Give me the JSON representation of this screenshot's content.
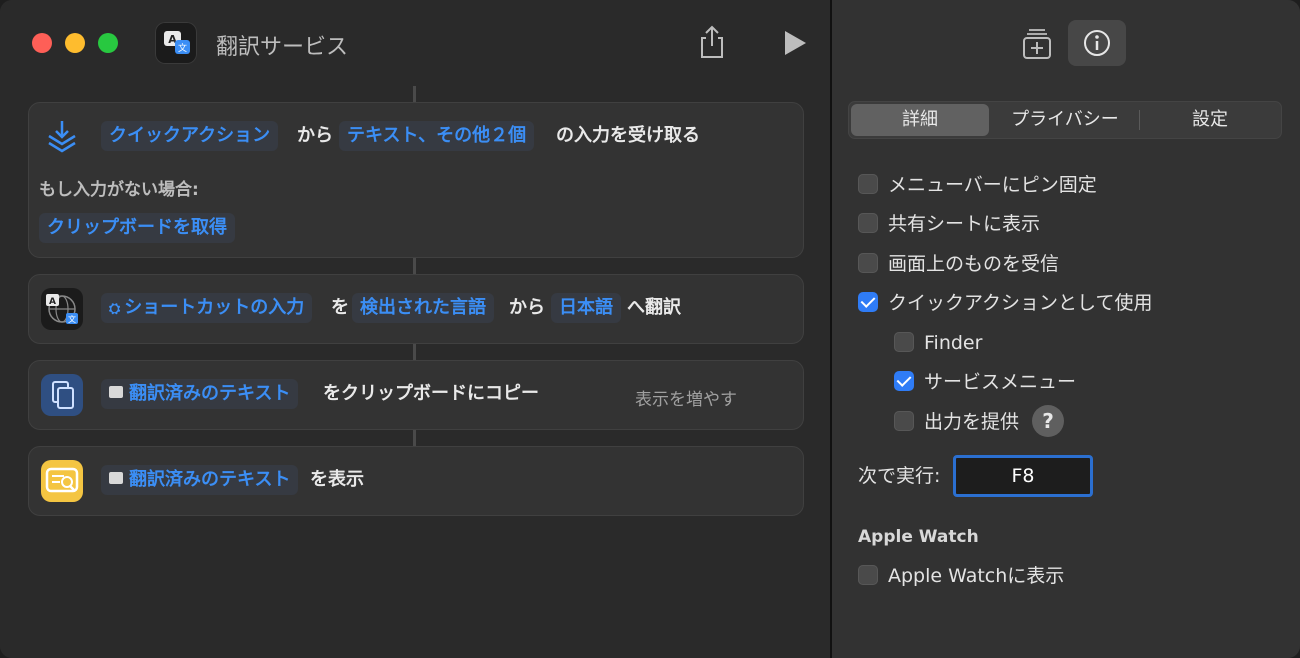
{
  "window": {
    "title": "翻訳サービス"
  },
  "actions": {
    "receive": {
      "token_type": "クイックアクション",
      "word_from": "から",
      "token_types": "テキスト、その他２個",
      "suffix": "の入力を受け取る",
      "if_no_input": "もし入力がない場合:",
      "fallback": "クリップボードを取得"
    },
    "translate": {
      "token_input": "ショートカットの入力",
      "word_wo": "を",
      "token_detected": "検出された言語",
      "word_from": "から",
      "token_lang": "日本語",
      "suffix": "へ翻訳"
    },
    "copy": {
      "token_text": "翻訳済みのテキスト",
      "suffix": "をクリップボードにコピー",
      "more": "表示を増やす"
    },
    "show": {
      "token_text": "翻訳済みのテキスト",
      "suffix": "を表示"
    }
  },
  "sidebar": {
    "tabs": [
      "詳細",
      "プライバシー",
      "設定"
    ],
    "active_tab": "詳細",
    "options": [
      {
        "label": "メニューバーにピン固定",
        "checked": false
      },
      {
        "label": "共有シートに表示",
        "checked": false
      },
      {
        "label": "画面上のものを受信",
        "checked": false
      },
      {
        "label": "クイックアクションとして使用",
        "checked": true
      },
      {
        "label": "Finder",
        "checked": false
      },
      {
        "label": "サービスメニュー",
        "checked": true
      },
      {
        "label": "出力を提供",
        "checked": false
      }
    ],
    "help_symbol": "?",
    "run_with_label": "次で実行:",
    "run_with_key": "F8",
    "watch_section": "Apple Watch",
    "watch_option": {
      "label": "Apple Watchに表示",
      "checked": false
    }
  },
  "colors": {
    "accent": "#2f7cf6",
    "token_text": "#3b8ef5",
    "card_bg": "#333333",
    "sidebar_bg": "#323232"
  },
  "icons": [
    "translate-app-icon",
    "share-icon",
    "play-icon",
    "add-to-library-icon",
    "info-icon",
    "receive-input-icon",
    "translate-globe-icon",
    "copy-clipboard-icon",
    "show-result-icon"
  ]
}
